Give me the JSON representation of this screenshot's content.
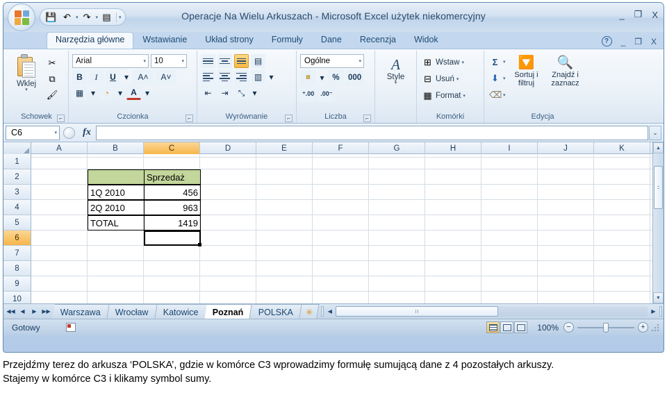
{
  "window": {
    "title": "Operacje Na Wielu Arkuszach - Microsoft Excel użytek niekomercyjny",
    "minimize": "_",
    "maximize": "❐",
    "close": "X"
  },
  "quick_access": {
    "office_button": "office-button",
    "save": "💾",
    "undo": "↶",
    "redo": "↷",
    "grid": "▤",
    "customize": "▾"
  },
  "ribbon": {
    "tabs": [
      {
        "label": "Narzędzia główne",
        "active": true
      },
      {
        "label": "Wstawianie",
        "active": false
      },
      {
        "label": "Układ strony",
        "active": false
      },
      {
        "label": "Formuły",
        "active": false
      },
      {
        "label": "Dane",
        "active": false
      },
      {
        "label": "Recenzja",
        "active": false
      },
      {
        "label": "Widok",
        "active": false
      }
    ],
    "help": "?",
    "minimize_ribbon": "_",
    "restore": "❐",
    "close": "X",
    "groups": {
      "clipboard": {
        "label": "Schowek",
        "paste": "Wklej",
        "paste_caret": "▾",
        "cut": "✂",
        "copy": "⧉",
        "format_painter": "🖌"
      },
      "font": {
        "label": "Czcionka",
        "font_name": "Arial",
        "font_size": "10",
        "bold": "B",
        "italic": "I",
        "underline": "U",
        "underline_caret": "▾",
        "grow_font": "A˄",
        "shrink_font": "A˅",
        "borders": "▦",
        "borders_caret": "▾",
        "fill_color": "◔",
        "fill_caret": "▾",
        "font_color": "A",
        "font_caret": "▾"
      },
      "alignment": {
        "label": "Wyrównanie",
        "align_top": "top-align",
        "align_middle": "middle-align",
        "align_bottom": "bottom-align",
        "wrap_text": "▤",
        "align_left": "left-align",
        "align_center": "center-align",
        "align_right": "right-align",
        "merge_center": "▥",
        "merge_caret": "▾",
        "decrease_indent": "⇤",
        "increase_indent": "⇥",
        "orientation": "⤡",
        "orientation_caret": "▾"
      },
      "number": {
        "label": "Liczba",
        "format": "Ogólne",
        "format_caret": "▾",
        "accounting": "¤",
        "accounting_caret": "▾",
        "percent": "%",
        "comma": "000",
        "increase_decimal": "⁺.00",
        "decrease_decimal": ".00⁻"
      },
      "styles": {
        "label": "",
        "styles_btn": "Style",
        "styles_caret": "▾",
        "styles_icon": "A"
      },
      "cells": {
        "label": "Komórki",
        "insert": "Wstaw",
        "insert_caret": "▾",
        "delete": "Usuń",
        "delete_caret": "▾",
        "format": "Format",
        "format_caret": "▾",
        "insert_icon": "⊞",
        "delete_icon": "⊟",
        "format_icon": "▦"
      },
      "editing": {
        "label": "Edycja",
        "autosum": "Σ",
        "autosum_caret": "▾",
        "fill": "⬇",
        "fill_caret": "▾",
        "clear": "⌫",
        "clear_caret": "▾",
        "sort_filter_l1": "Sortuj i",
        "sort_filter_l2": "filtruj",
        "sort_filter_caret": "▾",
        "sort_icon": "🔽",
        "find_select_l1": "Znajdź i",
        "find_select_l2": "zaznacz",
        "find_select_caret": "▾",
        "find_icon": "🔍"
      }
    }
  },
  "formula_bar": {
    "name_box": "C6",
    "name_box_caret": "▾",
    "fx": "fx",
    "formula_value": "",
    "formula_placeholder": "",
    "expand": "⌄"
  },
  "grid": {
    "columns": [
      "A",
      "B",
      "C",
      "D",
      "E",
      "F",
      "G",
      "H",
      "I",
      "J",
      "K"
    ],
    "selected_column": "C",
    "rows": [
      "1",
      "2",
      "3",
      "4",
      "5",
      "6",
      "7",
      "8",
      "9",
      "10"
    ],
    "selected_row": "6",
    "selected_cell": "C6",
    "cells": [
      {
        "ref": "C2",
        "value": "Sprzedaż",
        "align": "left",
        "fill": "#c3d69b"
      },
      {
        "ref": "B3",
        "value": "1Q 2010",
        "align": "left",
        "fill": ""
      },
      {
        "ref": "C3",
        "value": "456",
        "align": "right",
        "fill": ""
      },
      {
        "ref": "B4",
        "value": "2Q 2010",
        "align": "left",
        "fill": ""
      },
      {
        "ref": "C4",
        "value": "963",
        "align": "right",
        "fill": ""
      },
      {
        "ref": "B5",
        "value": "TOTAL",
        "align": "left",
        "fill": ""
      },
      {
        "ref": "C5",
        "value": "1419",
        "align": "right",
        "fill": ""
      }
    ],
    "header_fill_color": "#c3d69b",
    "scroll_up": "▲",
    "scroll_down": "▼"
  },
  "sheet_tabs": {
    "nav_first": "◀◀",
    "nav_prev": "◀",
    "nav_next": "▶",
    "nav_last": "▶▶",
    "tabs": [
      {
        "label": "Warszawa",
        "active": false
      },
      {
        "label": "Wrocław",
        "active": false
      },
      {
        "label": "Katowice",
        "active": false
      },
      {
        "label": "Poznań",
        "active": true
      },
      {
        "label": "POLSKA",
        "active": false
      }
    ],
    "insert_sheet": "✳",
    "hscroll_left": "◀",
    "hscroll_right": "▶"
  },
  "status_bar": {
    "status": "Gotowy",
    "macro_record": "record-macro",
    "view_normal": "normal-view",
    "view_layout": "page-layout-view",
    "view_break": "page-break-view",
    "zoom": "100%",
    "zoom_out": "−",
    "zoom_in": "+"
  },
  "caption": {
    "line1": "Przejdźmy terez do arkusza ‘POLSKA’, gdzie w komórce C3 wprowadzimy formułę sumującą dane z 4 pozostałych arkuszy.",
    "line2": "Stajemy w komórce C3 i klikamy symbol sumy."
  }
}
